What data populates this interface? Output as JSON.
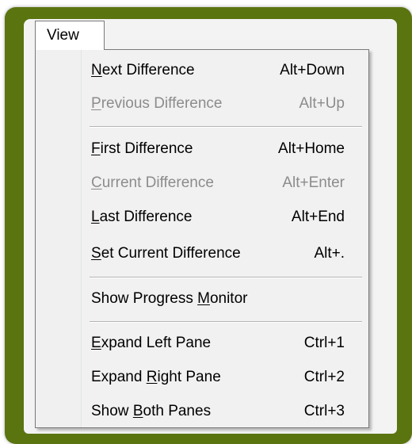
{
  "menubar": {
    "view_label": "View"
  },
  "menu": {
    "items": [
      {
        "pre": "",
        "mn": "N",
        "post": "ext Difference",
        "shortcut": "Alt+Down",
        "enabled": true
      },
      {
        "pre": "",
        "mn": "P",
        "post": "revious Difference",
        "shortcut": "Alt+Up",
        "enabled": false
      },
      {
        "pre": "",
        "mn": "F",
        "post": "irst Difference",
        "shortcut": "Alt+Home",
        "enabled": true
      },
      {
        "pre": "",
        "mn": "C",
        "post": "urrent Difference",
        "shortcut": "Alt+Enter",
        "enabled": false
      },
      {
        "pre": "",
        "mn": "L",
        "post": "ast Difference",
        "shortcut": "Alt+End",
        "enabled": true
      },
      {
        "pre": "",
        "mn": "S",
        "post": "et Current Difference",
        "shortcut": "Alt+.",
        "enabled": true
      },
      {
        "pre": "Show Progress ",
        "mn": "M",
        "post": "onitor",
        "shortcut": "",
        "enabled": true
      },
      {
        "pre": "",
        "mn": "E",
        "post": "xpand Left Pane",
        "shortcut": "Ctrl+1",
        "enabled": true
      },
      {
        "pre": "Expand ",
        "mn": "R",
        "post": "ight Pane",
        "shortcut": "Ctrl+2",
        "enabled": true
      },
      {
        "pre": "Show ",
        "mn": "B",
        "post": "oth Panes",
        "shortcut": "Ctrl+3",
        "enabled": true
      }
    ]
  },
  "colors": {
    "frame": "#5a7410",
    "disabled_text": "#8c8c8c",
    "enabled_text": "#000000"
  }
}
